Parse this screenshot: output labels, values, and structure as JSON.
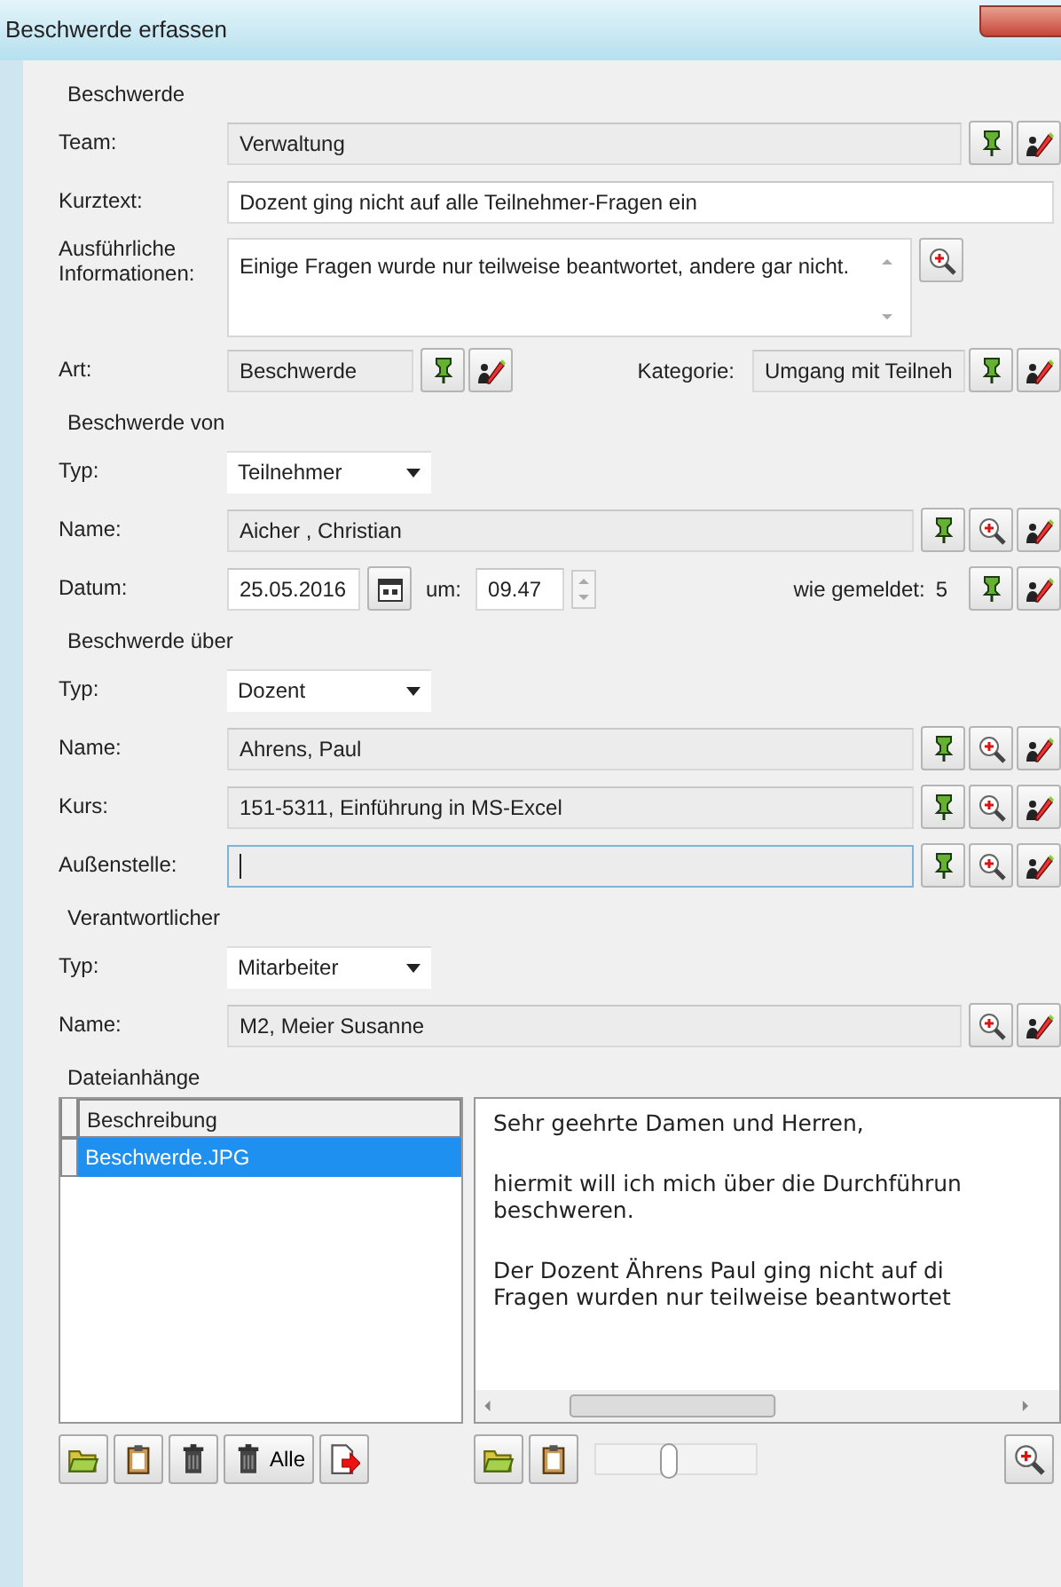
{
  "window": {
    "title": "Beschwerde erfassen"
  },
  "sections": [
    {
      "title": "Beschwerde",
      "rows": [
        {
          "kind": "field",
          "label": "Team:",
          "value": "Verwaltung",
          "readonly": true,
          "focused": false,
          "pin_button": true,
          "edit_button": true
        },
        {
          "kind": "field",
          "label": "Kurztext:",
          "value": "Dozent ging nicht auf alle Teilnehmer-Fragen ein",
          "readonly": false,
          "focused": false
        },
        {
          "kind": "memo",
          "label": "Ausführliche Informationen:",
          "value": "Einige Fragen wurde nur teilweise beantwortet, andere gar nicht.",
          "zoom_button": true
        },
        {
          "kind": "pair",
          "label": "Art:",
          "value": "Beschwerde",
          "pin_button": true,
          "edit_button": true,
          "label2": "Kategorie:",
          "value2": "Umgang mit Teilneh",
          "pin_button2": true,
          "edit_button2": true
        }
      ]
    },
    {
      "title": "Beschwerde von",
      "rows": [
        {
          "kind": "combo",
          "label": "Typ:",
          "value": "Teilnehmer"
        },
        {
          "kind": "field",
          "label": "Name:",
          "value": "Aicher , Christian",
          "readonly": true,
          "focused": false,
          "pin_button": true,
          "zoom_button": true,
          "edit_button": true
        },
        {
          "kind": "date",
          "label": "Datum:",
          "date": "25.05.2016",
          "time_label": "um:",
          "time": "09.47",
          "label2": "wie gemeldet:",
          "value2": "5",
          "pin_button": true,
          "edit_button": true
        }
      ]
    },
    {
      "title": "Beschwerde über",
      "rows": [
        {
          "kind": "combo",
          "label": "Typ:",
          "value": "Dozent"
        },
        {
          "kind": "field",
          "label": "Name:",
          "value": "Ahrens, Paul",
          "readonly": true,
          "focused": false,
          "pin_button": true,
          "zoom_button": true,
          "edit_button": true
        },
        {
          "kind": "field",
          "label": "Kurs:",
          "value": "151-5311, Einführung in MS-Excel",
          "readonly": true,
          "focused": false,
          "pin_button": true,
          "zoom_button": true,
          "edit_button": true
        },
        {
          "kind": "field",
          "label": "Außenstelle:",
          "readonly": true,
          "focused": true,
          "pin_button": true,
          "zoom_button": true,
          "edit_button": true
        }
      ]
    },
    {
      "title": "Verantwortlicher",
      "rows": [
        {
          "kind": "combo",
          "label": "Typ:",
          "value": "Mitarbeiter"
        },
        {
          "kind": "field",
          "label": "Name:",
          "value": "M2, Meier Susanne",
          "readonly": true,
          "focused": false,
          "zoom_button": true,
          "edit_button": true
        }
      ]
    }
  ],
  "attachments": {
    "title": "Dateianhänge",
    "columns": [
      "Beschreibung"
    ],
    "rows": [
      {
        "cells": [
          "Beschwerde.JPG"
        ],
        "selected": true
      }
    ],
    "preview": [
      [
        "Sehr geehrte Damen und Herren,"
      ],
      [
        "hiermit will ich mich über die Durchführun",
        "beschweren."
      ],
      [
        "Der Dozent Ährens Paul ging nicht auf di",
        "Fragen wurden nur teilweise beantwortet"
      ]
    ],
    "left_tools": [
      {
        "kind": "folder"
      },
      {
        "kind": "clipboard"
      },
      {
        "kind": "trash"
      },
      {
        "kind": "trash",
        "label": "Alle"
      },
      {
        "kind": "export"
      }
    ],
    "right_tools": [
      {
        "kind": "folder"
      },
      {
        "kind": "clipboard"
      },
      {
        "kind": "slider",
        "level": 0.45
      },
      {
        "kind": "zoom"
      }
    ]
  }
}
